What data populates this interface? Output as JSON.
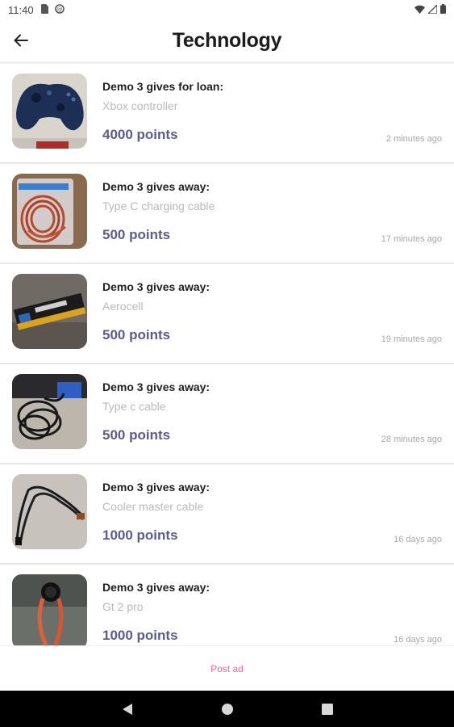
{
  "status_bar": {
    "time": "11:40"
  },
  "header": {
    "title": "Technology"
  },
  "items": [
    {
      "giver": "Demo 3 gives for loan:",
      "name": "Xbox controller",
      "points": "4000 points",
      "time": "2 minutes ago"
    },
    {
      "giver": "Demo 3 gives away:",
      "name": "Type C charging cable",
      "points": "500 points",
      "time": "17 minutes ago"
    },
    {
      "giver": "Demo 3 gives away:",
      "name": "Aerocell",
      "points": "500 points",
      "time": "19 minutes ago"
    },
    {
      "giver": "Demo 3 gives away:",
      "name": "Type c cable",
      "points": "500 points",
      "time": "28 minutes ago"
    },
    {
      "giver": "Demo 3 gives away:",
      "name": "Cooler master cable",
      "points": "1000 points",
      "time": "16 days ago"
    },
    {
      "giver": "Demo 3 gives away:",
      "name": "Gt 2 pro",
      "points": "1000 points",
      "time": "16 days ago"
    }
  ],
  "footer": {
    "post_ad_label": "Post ad"
  },
  "colors": {
    "points": "#5c5a8e",
    "accent_pink": "#ef6aa5",
    "nav_bar": "#000000"
  }
}
